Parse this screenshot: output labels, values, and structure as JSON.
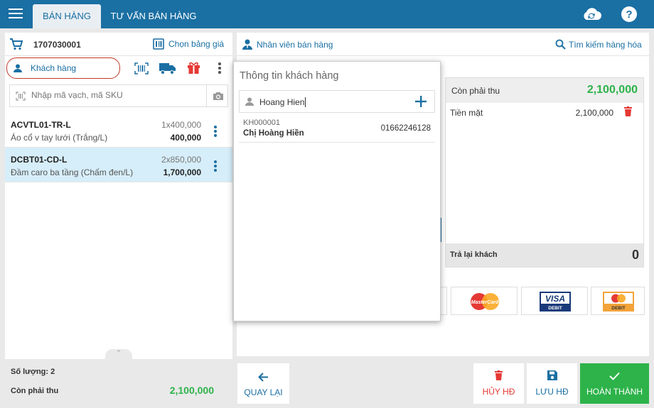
{
  "header": {
    "tabs": [
      {
        "label": "BÁN HÀNG",
        "active": true
      },
      {
        "label": "TƯ VẤN BÁN HÀNG",
        "active": false
      }
    ],
    "icons": [
      "menu-icon",
      "cloud-sync-icon",
      "help-icon"
    ]
  },
  "left": {
    "invoice_code": "1707030001",
    "price_list_label": "Chọn bảng giá",
    "customer_label": "Khách hàng",
    "search_placeholder": "Nhập mã vạch, mã SKU",
    "items": [
      {
        "code": "ACVTL01-TR-L",
        "desc": "Áo cổ v tay lưới (Trắng/L)",
        "qty": "1x400,000",
        "amount": "400,000"
      },
      {
        "code": "DCBT01-CD-L",
        "desc": "Đầm caro ba tầng (Chấm đen/L)",
        "qty": "2x850,000",
        "amount": "1,700,000"
      }
    ],
    "quantity_label": "Số lượng: 2",
    "due_label": "Còn phải thu",
    "due_value": "2,100,000"
  },
  "right": {
    "staff_label": "Nhân viên bán hàng",
    "search_goods_label": "Tìm kiếm hàng hóa",
    "due_label": "Còn phải thu",
    "due_value": "2,100,000",
    "cash_label": "Tiền mặt",
    "cash_value": "2,100,000",
    "change_label": "Trả lại khách",
    "change_value": "0"
  },
  "popup": {
    "title": "Thông tin khách hàng",
    "input_value": "Hoang Hien",
    "result": {
      "code": "KH000001",
      "name": "Chị Hoàng Hiền",
      "phone": "01662246128"
    }
  },
  "cards": [
    {
      "label": "MasterCard",
      "sub": ""
    },
    {
      "label": "VISA",
      "sub": "DEBIT"
    },
    {
      "label": "",
      "sub": "DEBIT"
    }
  ],
  "actions": {
    "back": "QUAY LẠI",
    "cancel": "HỦY HĐ",
    "save": "LƯU HĐ",
    "complete": "HOÀN THÀNH"
  },
  "colors": {
    "primary": "#1a6fa3",
    "success": "#2db34a",
    "danger": "#e53935"
  }
}
